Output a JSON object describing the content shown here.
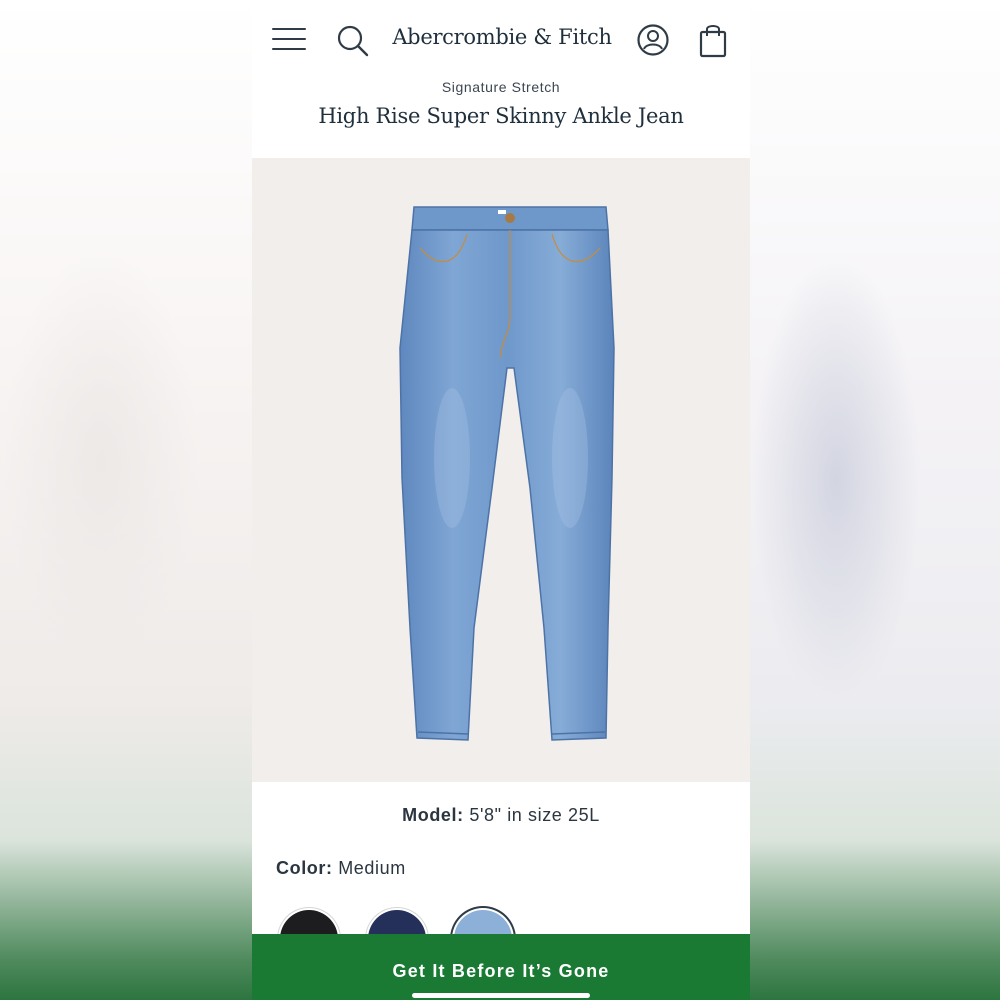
{
  "header": {
    "brand": "Abercrombie & Fitch",
    "icons": [
      "menu-icon",
      "search-icon",
      "account-icon",
      "shopping-bag-icon"
    ]
  },
  "product": {
    "collection": "Signature Stretch",
    "title": "High Rise Super Skinny Ankle Jean",
    "model_label": "Model:",
    "model_value": "5'8\" in size 25L",
    "color_label": "Color:",
    "color_value": "Medium",
    "swatches": [
      {
        "name": "black",
        "color": "#1d1d1f",
        "selected": false
      },
      {
        "name": "dark-wash",
        "color": "#25305a",
        "selected": false
      },
      {
        "name": "medium-wash",
        "color": "#8cb0d8",
        "selected": true
      }
    ]
  },
  "cta": {
    "label": "Get It Before It’s Gone",
    "color": "#1a7a34"
  }
}
